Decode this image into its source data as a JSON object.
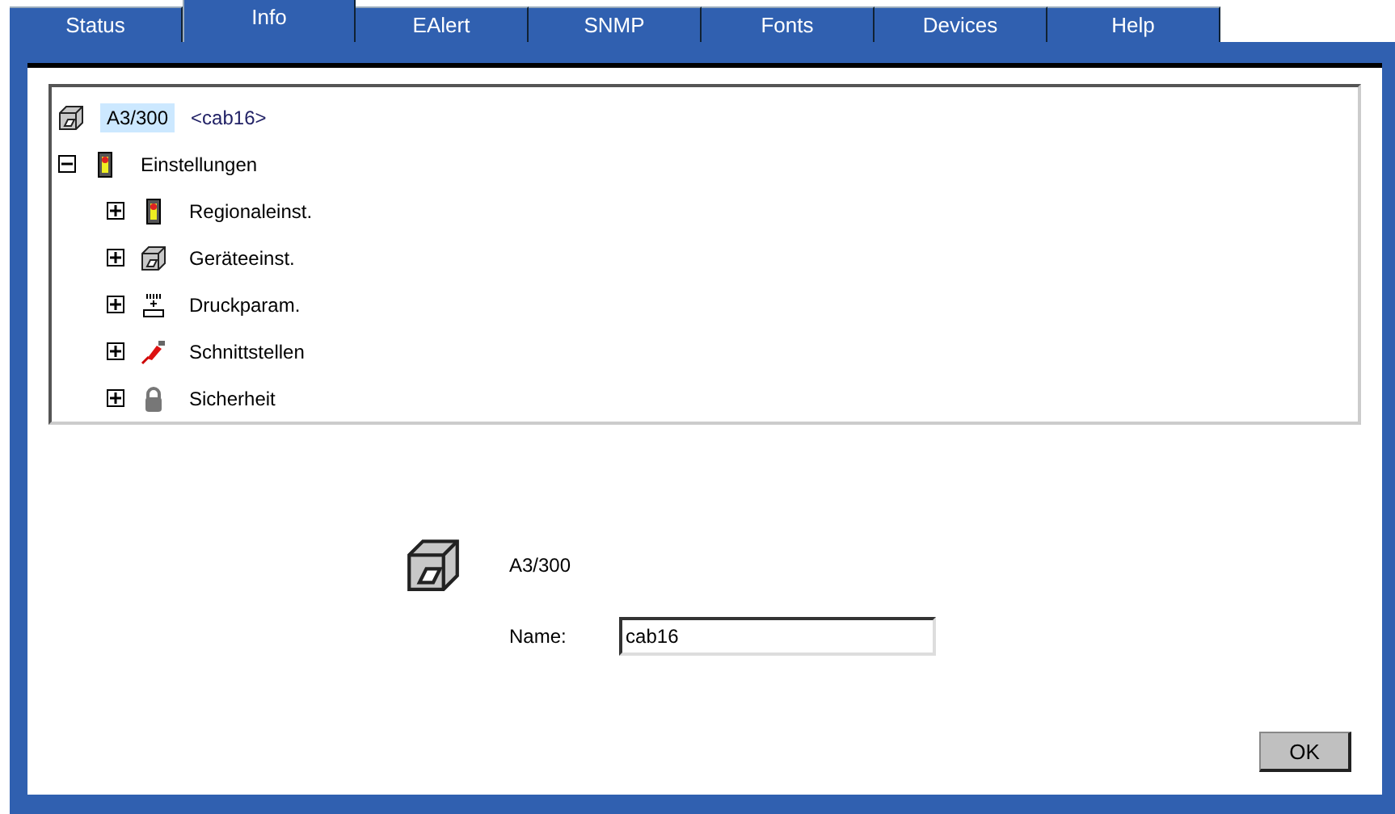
{
  "tabs": [
    {
      "label": "Status",
      "selected": false
    },
    {
      "label": "Info",
      "selected": true
    },
    {
      "label": "EAlert",
      "selected": false
    },
    {
      "label": "SNMP",
      "selected": false
    },
    {
      "label": "Fonts",
      "selected": false
    },
    {
      "label": "Devices",
      "selected": false
    },
    {
      "label": "Help",
      "selected": false
    }
  ],
  "tree": {
    "label": "A3/300",
    "selected": true,
    "tag": "<cab16>",
    "kind": "device",
    "children": [
      {
        "label": "Einstellungen",
        "kind": "settings",
        "expanded": true,
        "children": [
          {
            "label": "Regionaleinst.",
            "kind": "settings",
            "expanded": false
          },
          {
            "label": "Geräteeinst.",
            "kind": "device",
            "expanded": false
          },
          {
            "label": "Druckparam.",
            "kind": "print",
            "expanded": false
          },
          {
            "label": "Schnittstellen",
            "kind": "interface",
            "expanded": false
          },
          {
            "label": "Sicherheit",
            "kind": "security",
            "expanded": false
          }
        ]
      }
    ]
  },
  "details": {
    "model": "A3/300",
    "name_label": "Name:",
    "name_value": "cab16"
  },
  "buttons": [
    "OK"
  ]
}
